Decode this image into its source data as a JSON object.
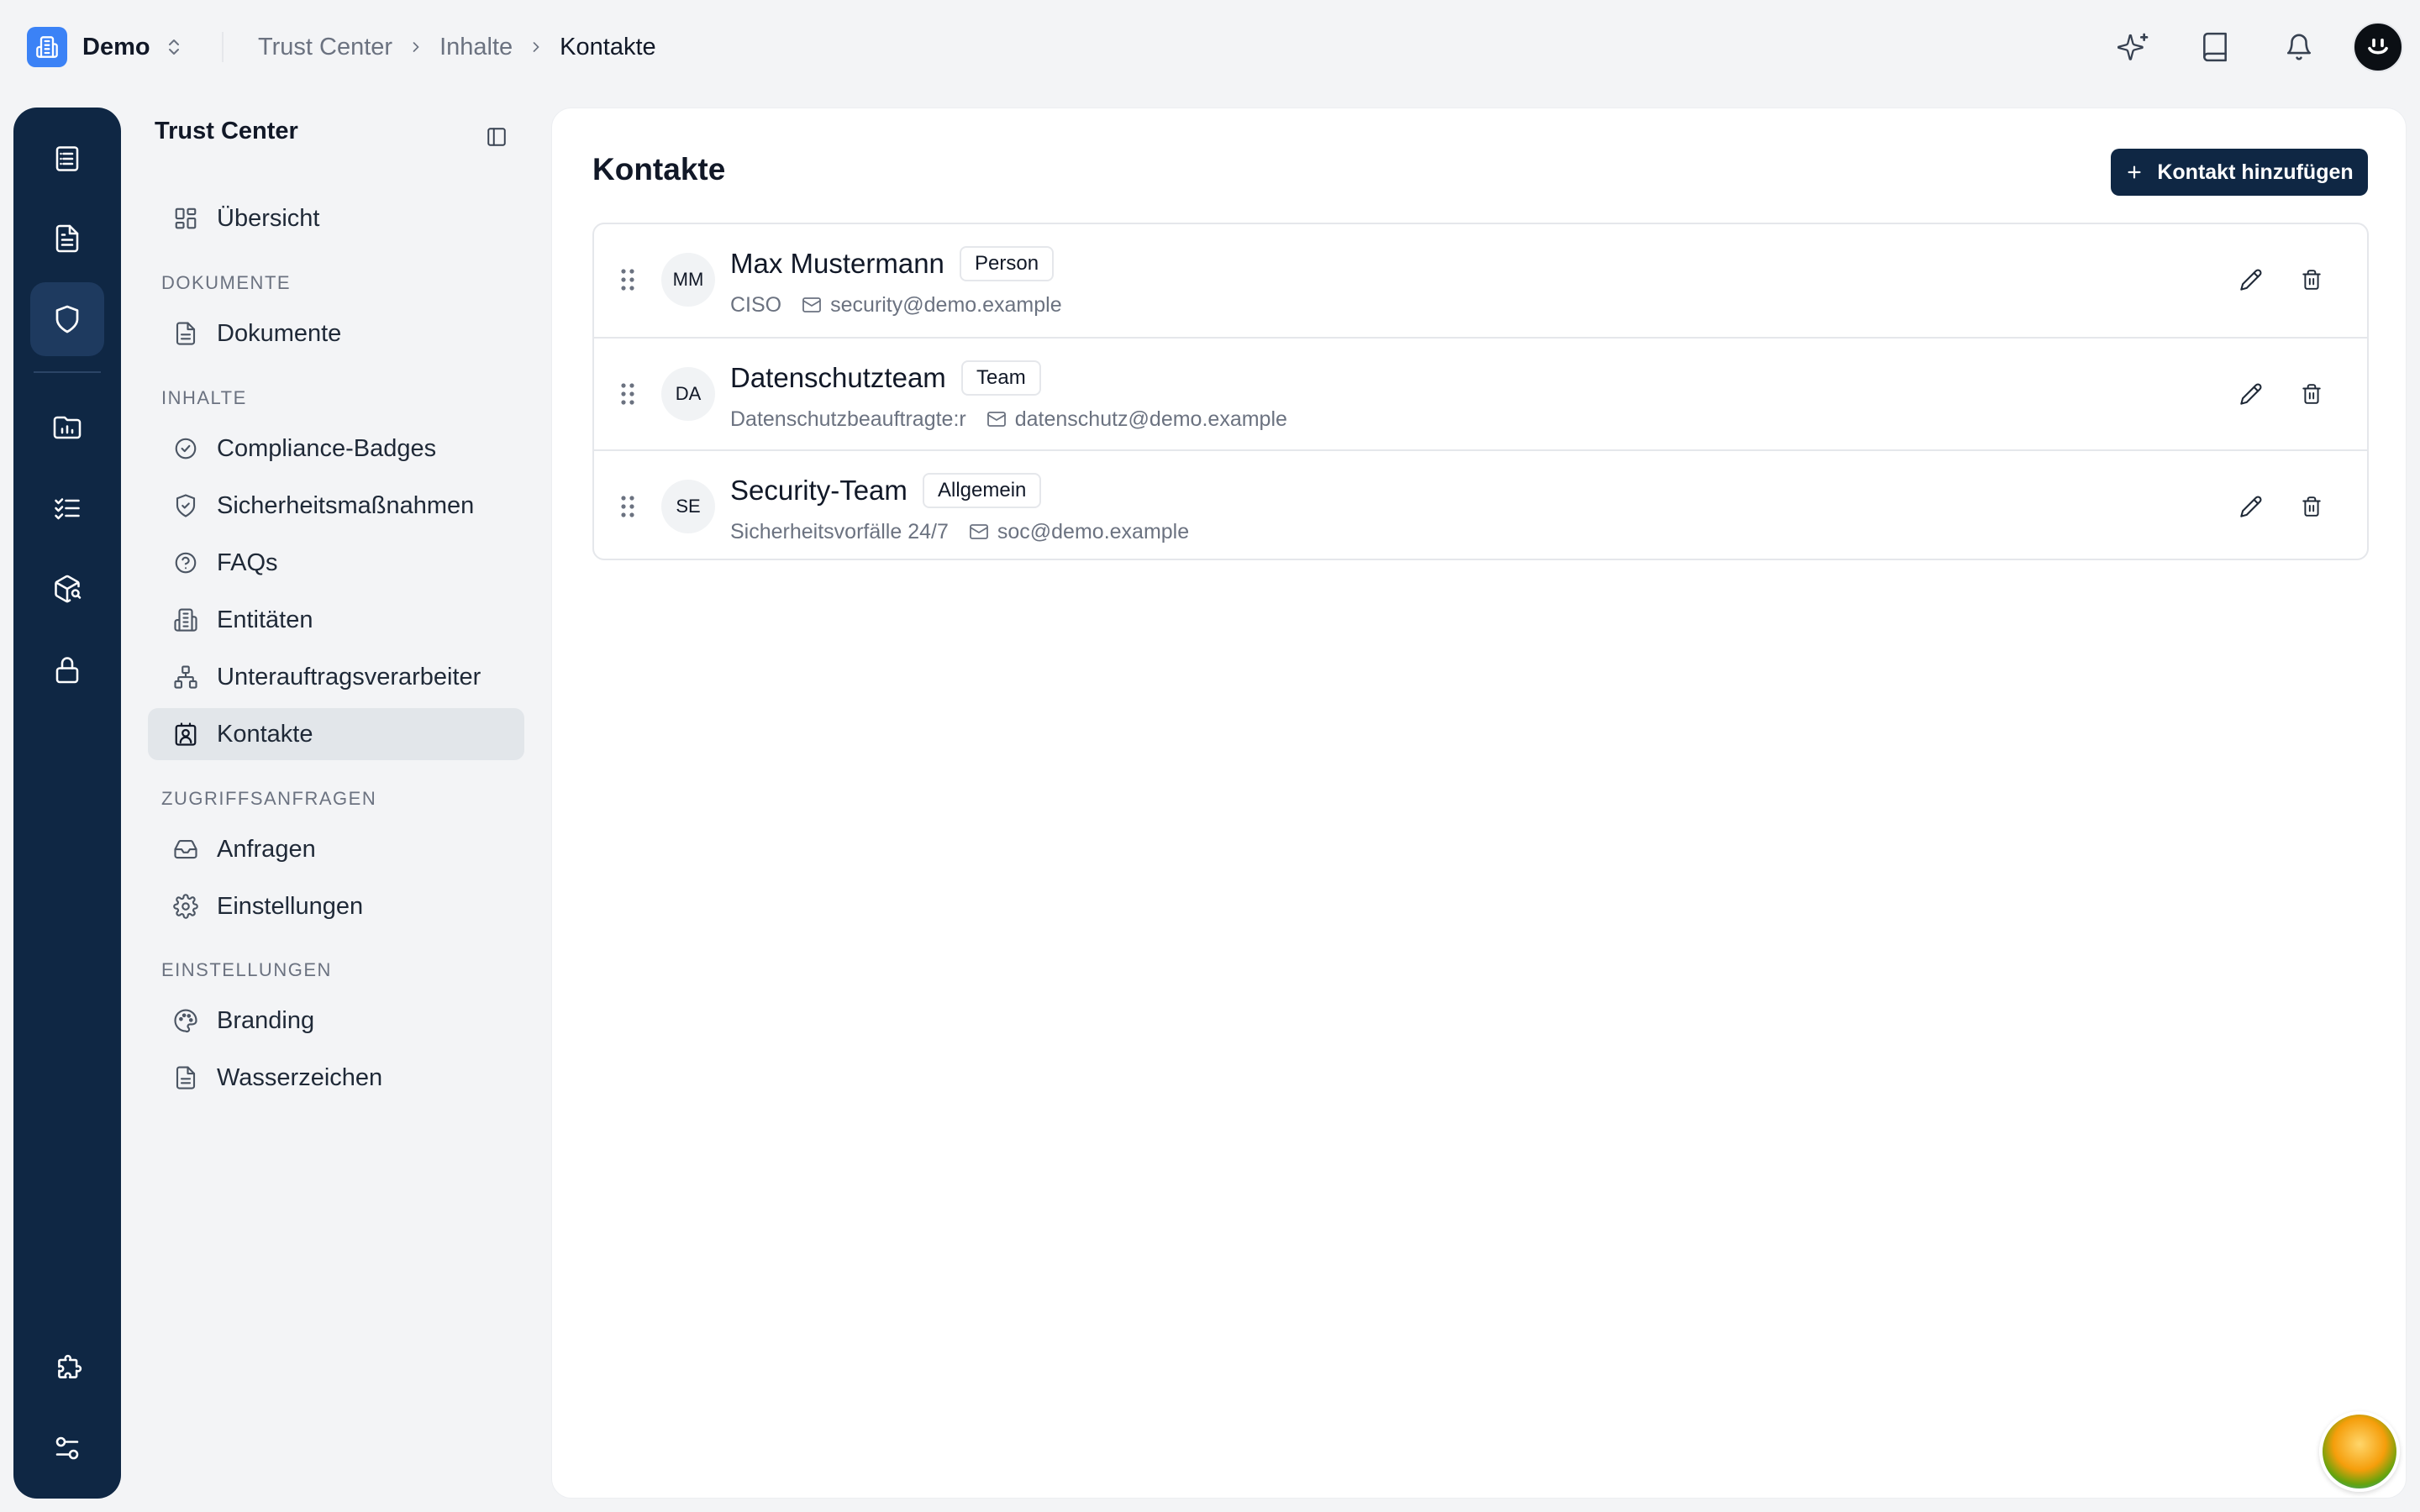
{
  "org": {
    "name": "Demo"
  },
  "breadcrumb": [
    "Trust Center",
    "Inhalte",
    "Kontakte"
  ],
  "sidebar": {
    "title": "Trust Center",
    "overview": "Übersicht",
    "sections": {
      "documents": "DOKUMENTE",
      "content": "INHALTE",
      "access": "ZUGRIFFSANFRAGEN",
      "settings": "EINSTELLUNGEN"
    },
    "items": {
      "documents": "Dokumente",
      "badges": "Compliance-Badges",
      "measures": "Sicherheitsmaßnahmen",
      "faqs": "FAQs",
      "entities": "Entitäten",
      "subprocessors": "Unterauftragsverarbeiter",
      "contacts": "Kontakte",
      "requests": "Anfragen",
      "request_settings": "Einstellungen",
      "branding": "Branding",
      "watermark": "Wasserzeichen"
    }
  },
  "main": {
    "title": "Kontakte",
    "add_button": "Kontakt hinzufügen",
    "contacts": [
      {
        "initials": "MM",
        "name": "Max Mustermann",
        "type": "Person",
        "role": "CISO",
        "email": "security@demo.example"
      },
      {
        "initials": "DA",
        "name": "Datenschutzteam",
        "type": "Team",
        "role": "Datenschutzbeauftragte:r",
        "email": "datenschutz@demo.example"
      },
      {
        "initials": "SE",
        "name": "Security-Team",
        "type": "Allgemein",
        "role": "Sicherheitsvorfälle 24/7",
        "email": "soc@demo.example"
      }
    ]
  },
  "colors": {
    "rail": "#0f2744",
    "primary_button": "#0f2744",
    "org_logo": "#3b82f6",
    "active_nav": "#e2e6ea"
  }
}
